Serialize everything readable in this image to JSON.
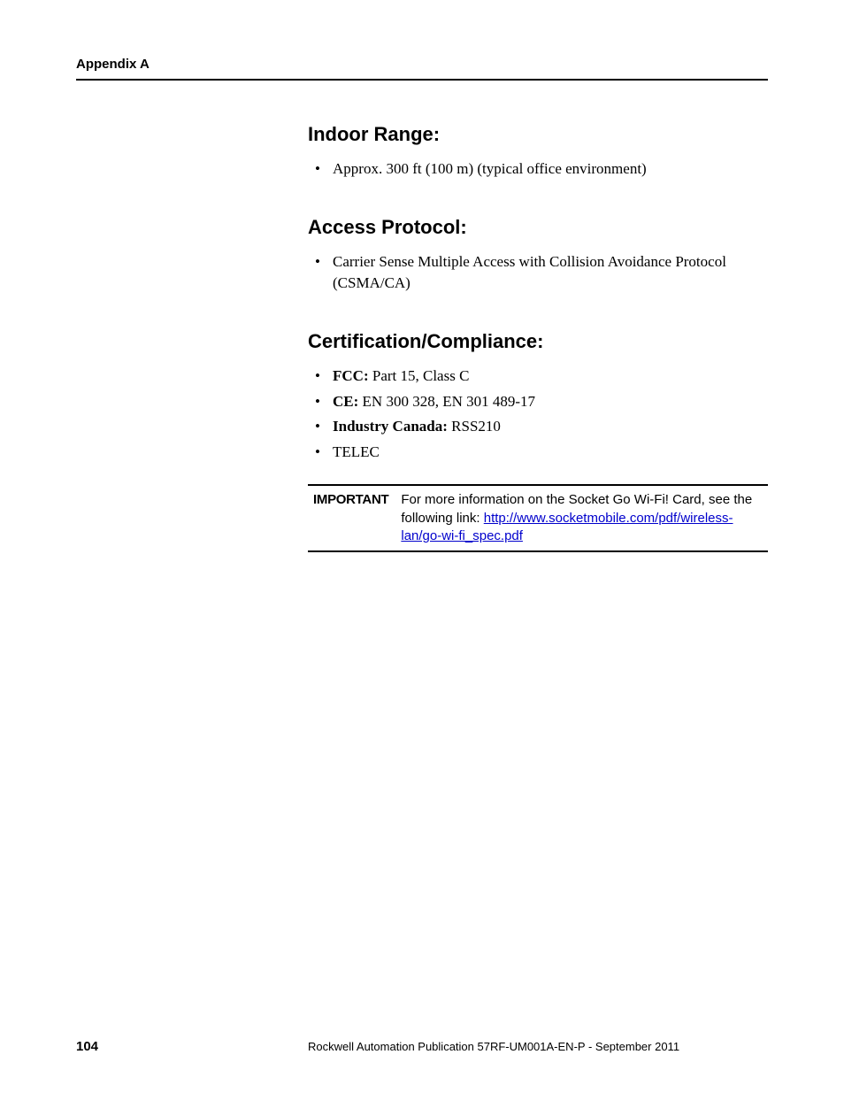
{
  "header": {
    "appendix": "Appendix A"
  },
  "sections": [
    {
      "heading": "Indoor Range:",
      "items": [
        {
          "bold": "",
          "text": "Approx. 300 ft (100 m) (typical office environment)"
        }
      ]
    },
    {
      "heading": "Access Protocol:",
      "items": [
        {
          "bold": "",
          "text": "Carrier Sense Multiple Access with Collision Avoidance Protocol (CSMA/CA)"
        }
      ]
    },
    {
      "heading": "Certification/Compliance:",
      "items": [
        {
          "bold": "FCC:",
          "text": " Part 15, Class C"
        },
        {
          "bold": "CE:",
          "text": " EN 300 328, EN 301 489-17"
        },
        {
          "bold": "Industry Canada:",
          "text": " RSS210"
        },
        {
          "bold": "",
          "text": "TELEC"
        }
      ]
    }
  ],
  "important": {
    "label": "IMPORTANT",
    "pre": "For more information on the Socket Go Wi-Fi! Card, see the following link: ",
    "link": "http://www.socketmobile.com/pdf/wireless-lan/go-wi-fi_spec.pdf"
  },
  "footer": {
    "page": "104",
    "text": "Rockwell Automation Publication 57RF-UM001A-EN-P - September 2011"
  }
}
